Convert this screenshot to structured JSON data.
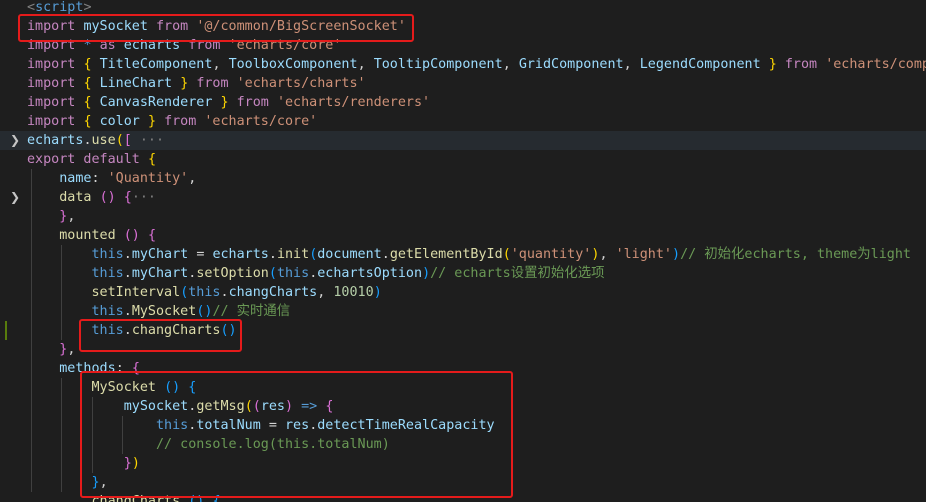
{
  "editor": {
    "lines": [
      [
        [
          "tag",
          "<"
        ],
        [
          "tagn",
          "script"
        ],
        [
          "tag",
          ">"
        ]
      ],
      [
        [
          "k",
          "import "
        ],
        [
          "v",
          "mySocket "
        ],
        [
          "k",
          "from "
        ],
        [
          "s",
          "'@/common/BigScreenSocket'"
        ]
      ],
      [
        [
          "k",
          "import "
        ],
        [
          "kb",
          "* "
        ],
        [
          "k",
          "as "
        ],
        [
          "v",
          "echarts "
        ],
        [
          "k",
          "from "
        ],
        [
          "s",
          "'echarts/core'"
        ]
      ],
      [
        [
          "k",
          "import "
        ],
        [
          "b1",
          "{ "
        ],
        [
          "v",
          "TitleComponent"
        ],
        [
          "p",
          ", "
        ],
        [
          "v",
          "ToolboxComponent"
        ],
        [
          "p",
          ", "
        ],
        [
          "v",
          "TooltipComponent"
        ],
        [
          "p",
          ", "
        ],
        [
          "v",
          "GridComponent"
        ],
        [
          "p",
          ", "
        ],
        [
          "v",
          "LegendComponent "
        ],
        [
          "b1",
          "} "
        ],
        [
          "k",
          "from "
        ],
        [
          "s",
          "'echarts/components'"
        ]
      ],
      [
        [
          "k",
          "import "
        ],
        [
          "b1",
          "{ "
        ],
        [
          "v",
          "LineChart "
        ],
        [
          "b1",
          "} "
        ],
        [
          "k",
          "from "
        ],
        [
          "s",
          "'echarts/charts'"
        ]
      ],
      [
        [
          "k",
          "import "
        ],
        [
          "b1",
          "{ "
        ],
        [
          "v",
          "CanvasRenderer "
        ],
        [
          "b1",
          "} "
        ],
        [
          "k",
          "from "
        ],
        [
          "s",
          "'echarts/renderers'"
        ]
      ],
      [
        [
          "k",
          "import "
        ],
        [
          "b1",
          "{ "
        ],
        [
          "v",
          "color "
        ],
        [
          "b1",
          "} "
        ],
        [
          "k",
          "from "
        ],
        [
          "s",
          "'echarts/core'"
        ]
      ],
      [
        [
          "v",
          "echarts"
        ],
        [
          "p",
          "."
        ],
        [
          "f",
          "use"
        ],
        [
          "b1",
          "("
        ],
        [
          "b2",
          "["
        ],
        [
          "dim",
          " ···"
        ]
      ],
      [
        [
          "k",
          "export default "
        ],
        [
          "b1",
          "{"
        ]
      ],
      [
        [
          "p",
          "    "
        ],
        [
          "v",
          "name"
        ],
        [
          "p",
          ": "
        ],
        [
          "s",
          "'Quantity'"
        ],
        [
          "p",
          ","
        ]
      ],
      [
        [
          "p",
          "    "
        ],
        [
          "f",
          "data "
        ],
        [
          "b2",
          "() "
        ],
        [
          "b2",
          "{"
        ],
        [
          "dim",
          "···"
        ]
      ],
      [
        [
          "p",
          "    "
        ],
        [
          "b2",
          "}"
        ],
        [
          "p",
          ","
        ]
      ],
      [
        [
          "p",
          "    "
        ],
        [
          "f",
          "mounted "
        ],
        [
          "b2",
          "() "
        ],
        [
          "b2",
          "{"
        ]
      ],
      [
        [
          "p",
          "        "
        ],
        [
          "kb",
          "this"
        ],
        [
          "p",
          "."
        ],
        [
          "v",
          "myChart "
        ],
        [
          "p",
          "= "
        ],
        [
          "v",
          "echarts"
        ],
        [
          "p",
          "."
        ],
        [
          "f",
          "init"
        ],
        [
          "b3",
          "("
        ],
        [
          "v",
          "document"
        ],
        [
          "p",
          "."
        ],
        [
          "f",
          "getElementById"
        ],
        [
          "b1",
          "("
        ],
        [
          "s",
          "'quantity'"
        ],
        [
          "b1",
          ")"
        ],
        [
          "p",
          ", "
        ],
        [
          "s",
          "'light'"
        ],
        [
          "b3",
          ")"
        ],
        [
          "c",
          "// 初始化echarts, theme为light"
        ]
      ],
      [
        [
          "p",
          "        "
        ],
        [
          "kb",
          "this"
        ],
        [
          "p",
          "."
        ],
        [
          "v",
          "myChart"
        ],
        [
          "p",
          "."
        ],
        [
          "f",
          "setOption"
        ],
        [
          "b3",
          "("
        ],
        [
          "kb",
          "this"
        ],
        [
          "p",
          "."
        ],
        [
          "v",
          "echartsOption"
        ],
        [
          "b3",
          ")"
        ],
        [
          "c",
          "// echarts设置初始化选项"
        ]
      ],
      [
        [
          "p",
          "        "
        ],
        [
          "f",
          "setInterval"
        ],
        [
          "b3",
          "("
        ],
        [
          "kb",
          "this"
        ],
        [
          "p",
          "."
        ],
        [
          "v",
          "changCharts"
        ],
        [
          "p",
          ", "
        ],
        [
          "n",
          "10010"
        ],
        [
          "b3",
          ")"
        ]
      ],
      [
        [
          "p",
          "        "
        ],
        [
          "kb",
          "this"
        ],
        [
          "p",
          "."
        ],
        [
          "f",
          "MySocket"
        ],
        [
          "b3",
          "()"
        ],
        [
          "c",
          "// 实时通信"
        ]
      ],
      [
        [
          "p",
          "        "
        ],
        [
          "kb",
          "this"
        ],
        [
          "p",
          "."
        ],
        [
          "f",
          "changCharts"
        ],
        [
          "b3",
          "()"
        ]
      ],
      [
        [
          "p",
          "    "
        ],
        [
          "b2",
          "}"
        ],
        [
          "p",
          ","
        ]
      ],
      [
        [
          "p",
          "    "
        ],
        [
          "v",
          "methods"
        ],
        [
          "p",
          ": "
        ],
        [
          "b2",
          "{"
        ]
      ],
      [
        [
          "p",
          "        "
        ],
        [
          "f",
          "MySocket "
        ],
        [
          "b3",
          "() "
        ],
        [
          "b3",
          "{"
        ]
      ],
      [
        [
          "p",
          "            "
        ],
        [
          "v",
          "mySocket"
        ],
        [
          "p",
          "."
        ],
        [
          "f",
          "getMsg"
        ],
        [
          "b1",
          "("
        ],
        [
          "b2",
          "("
        ],
        [
          "v",
          "res"
        ],
        [
          "b2",
          ") "
        ],
        [
          "kb",
          "=> "
        ],
        [
          "b2",
          "{"
        ]
      ],
      [
        [
          "p",
          "                "
        ],
        [
          "kb",
          "this"
        ],
        [
          "p",
          "."
        ],
        [
          "v",
          "totalNum "
        ],
        [
          "p",
          "= "
        ],
        [
          "v",
          "res"
        ],
        [
          "p",
          "."
        ],
        [
          "v",
          "detectTimeRealCapacity"
        ]
      ],
      [
        [
          "p",
          "                "
        ],
        [
          "c",
          "// console.log(this.totalNum)"
        ]
      ],
      [
        [
          "p",
          "            "
        ],
        [
          "b2",
          "}"
        ],
        [
          "b1",
          ")"
        ]
      ],
      [
        [
          "p",
          "        "
        ],
        [
          "b3",
          "}"
        ],
        [
          "p",
          ","
        ]
      ],
      [
        [
          "p",
          "        "
        ],
        [
          "f",
          "changCharts "
        ],
        [
          "b3",
          "() "
        ],
        [
          "b3",
          "{"
        ]
      ]
    ],
    "fold_glyph": "❯",
    "accent_colors": {
      "background": "#1e1e1e",
      "annotation_box": "#e51b1b",
      "keyword": "#c586c0",
      "string": "#ce9178",
      "variable": "#9cdcfe",
      "function": "#dcdcaa",
      "comment": "#6a9955"
    }
  }
}
